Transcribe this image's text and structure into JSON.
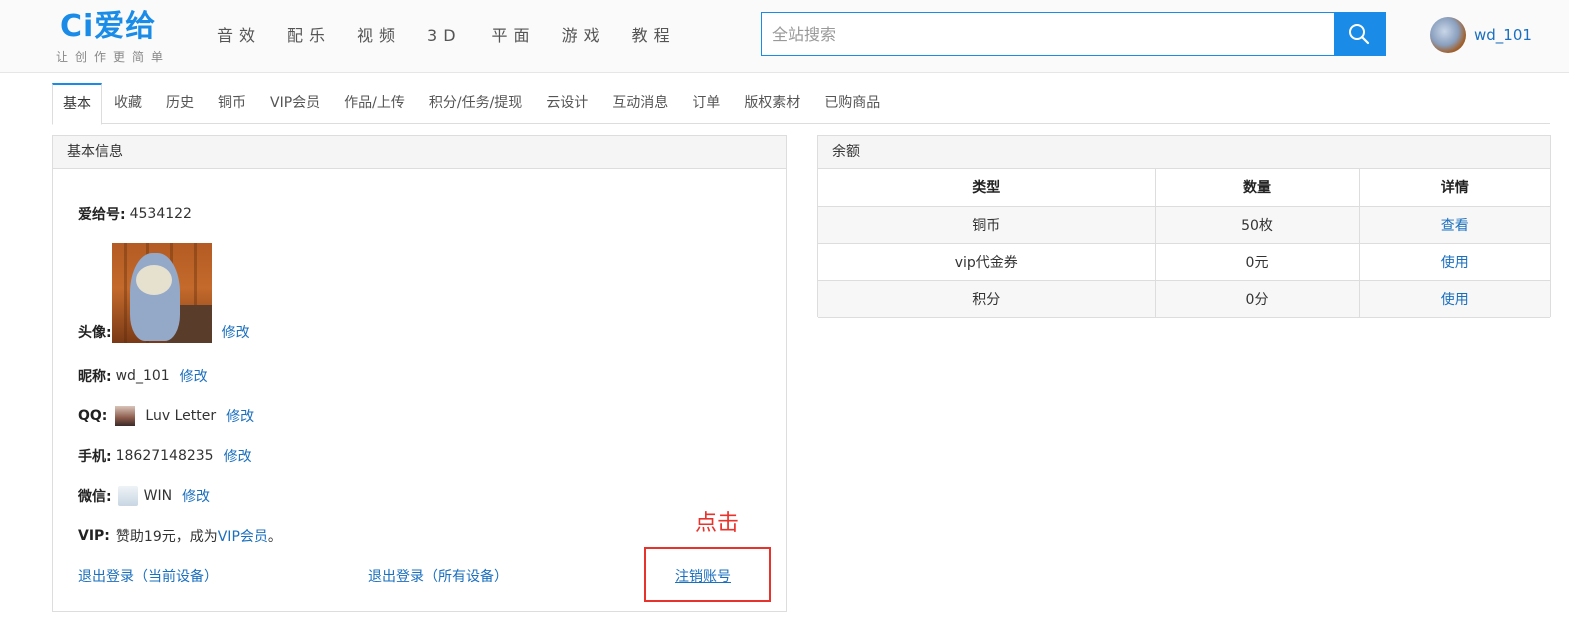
{
  "header": {
    "logo_text": "Ci爱给",
    "logo_slogan": "让创作更简单",
    "nav": [
      "音效",
      "配乐",
      "视频",
      "3D",
      "平面",
      "游戏",
      "教程"
    ],
    "search_placeholder": "全站搜索",
    "username": "wd_101"
  },
  "tabs": [
    "基本",
    "收藏",
    "历史",
    "铜币",
    "VIP会员",
    "作品/上传",
    "积分/任务/提现",
    "云设计",
    "互动消息",
    "订单",
    "版权素材",
    "已购商品"
  ],
  "basic": {
    "title": "基本信息",
    "id_label": "爱给号:",
    "id_value": "4534122",
    "avatar_label": "头像:",
    "edit": "修改",
    "nickname_label": "昵称:",
    "nickname_value": "wd_101",
    "qq_label": "QQ:",
    "qq_value": "Luv Letter",
    "phone_label": "手机:",
    "phone_value": "18627148235",
    "wechat_label": "微信:",
    "wechat_value": "WIN",
    "vip_label": "VIP:",
    "vip_text_pre": "赞助19元，成为",
    "vip_link": "VIP会员",
    "vip_text_post": "。",
    "logout_current": "退出登录（当前设备）",
    "logout_all": "退出登录（所有设备）",
    "cancel_account": "注销账号"
  },
  "annotation": {
    "click_label": "点击"
  },
  "balance": {
    "title": "余额",
    "headers": [
      "类型",
      "数量",
      "详情"
    ],
    "rows": [
      {
        "type": "铜币",
        "amount": "50枚",
        "action": "查看"
      },
      {
        "type": "vip代金券",
        "amount": "0元",
        "action": "使用"
      },
      {
        "type": "积分",
        "amount": "0分",
        "action": "使用"
      }
    ]
  },
  "colors": {
    "accent": "#1a8ce8",
    "link": "#1a6fbf",
    "annotation_red": "#e8332d"
  }
}
